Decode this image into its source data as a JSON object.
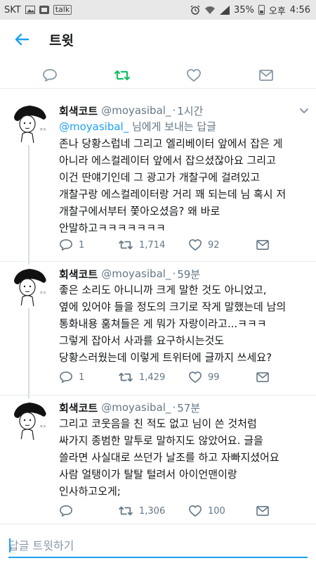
{
  "status_bar": {
    "carrier": "SKT",
    "battery": "35%",
    "ampm": "오후",
    "time": "4:56"
  },
  "app_bar": {
    "title": "트윗"
  },
  "tweets": [
    {
      "name": "회색코트",
      "handle": "@moyasibal_",
      "separator": "·",
      "time": "1시간",
      "reply_mention": "@moyasibal_",
      "reply_suffix": " 님에게 보내는 답글",
      "text": "존나 당황스럽네 그리고 엘리베이터 앞에서 잡은 게\n아니라 에스컬레이터 앞에서 잡으셨잖아요 그리고\n이건 딴얘기인데 그 광고가 개찰구에 걸려있고\n개찰구랑 에스컬레이터랑 거리 꽤 되는데 님 혹시 저\n개찰구에서부터 쫓아오셨음? 왜 바로\n안말하고ㅋㅋㅋㅋㅋㅋㅋ",
      "replies": "1",
      "retweets": "1,714",
      "likes": "92"
    },
    {
      "name": "회색코트",
      "handle": "@moyasibal_",
      "separator": "·",
      "time": "59분",
      "text": "좋은 소리도 아니니까 크게 말한 것도 아니었고,\n옆에 있어야 들을 정도의 크기로 작게 말했는데 남의\n통화내용 훔쳐들은 게 뭐가 자랑이라고...ㅋㅋㅋ\n그렇게 잡아서 사과를 요구하시는것도\n당황스러웠는데 이렇게 트위터에 글까지 쓰세요?",
      "replies": "1",
      "retweets": "1,429",
      "likes": "99"
    },
    {
      "name": "회색코트",
      "handle": "@moyasibal_",
      "separator": "·",
      "time": "57분",
      "text": "그리고 코웃음을 친 적도 없고 님이 쓴 것처럼\n싸가지 종범한 말투로 말하지도 않았어요. 글을\n쓸라면 사실대로 쓰던가 날조를 하고 자빠지셨어요\n사람 얼탱이가 탈탈 털려서 아이언맨이랑\n인사하고오게;",
      "replies": "",
      "retweets": "1,306",
      "likes": "100"
    }
  ],
  "reply_bar": {
    "placeholder": "답글 트윗하기"
  },
  "colors": {
    "accent": "#1da1f2",
    "retweet_active": "#17bf63",
    "muted": "#657786"
  }
}
